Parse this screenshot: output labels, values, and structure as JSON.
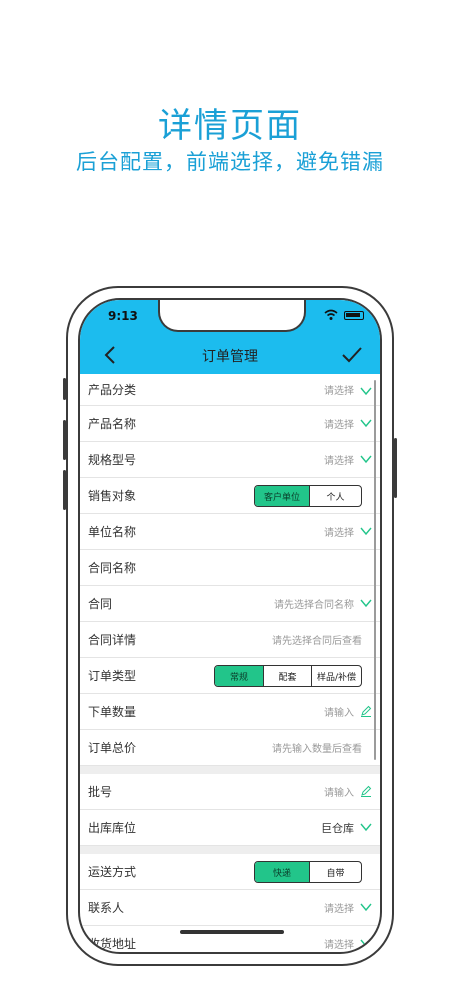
{
  "hero": {
    "title": "详情页面",
    "subtitle": "后台配置，前端选择，避免错漏"
  },
  "status_bar": {
    "time": "9:13"
  },
  "navbar": {
    "title": "订单管理"
  },
  "rows": {
    "r1": {
      "label": "产品分类",
      "value": "请选择"
    },
    "r2": {
      "label": "产品名称",
      "value": "请选择"
    },
    "r3": {
      "label": "规格型号",
      "value": "请选择"
    },
    "r4": {
      "label": "销售对象",
      "options": [
        "客户单位",
        "个人"
      ],
      "selected": "客户单位"
    },
    "r5": {
      "label": "单位名称",
      "value": "请选择"
    },
    "r6": {
      "label": "合同名称"
    },
    "r7": {
      "label": "合同",
      "value": "请先选择合同名称"
    },
    "r8": {
      "label": "合同详情",
      "value": "请先选择合同后查看"
    },
    "r9": {
      "label": "订单类型",
      "options": [
        "常规",
        "配套",
        "样品/补偿"
      ],
      "selected": "常规"
    },
    "r10": {
      "label": "下单数量",
      "value": "请输入"
    },
    "r11": {
      "label": "订单总价",
      "value": "请先输入数量后查看"
    },
    "r12": {
      "label": "批号",
      "value": "请输入"
    },
    "r13": {
      "label": "出库库位",
      "value": "巨仓库"
    },
    "r14": {
      "label": "运送方式",
      "options": [
        "快递",
        "自带"
      ],
      "selected": "快递"
    },
    "r15": {
      "label": "联系人",
      "value": "请选择"
    },
    "r16": {
      "label": "收货地址",
      "value": "请选择"
    }
  },
  "colors": {
    "accent": "#1cbcee",
    "hero_text": "#1aa0d6",
    "selected": "#22c58a"
  }
}
